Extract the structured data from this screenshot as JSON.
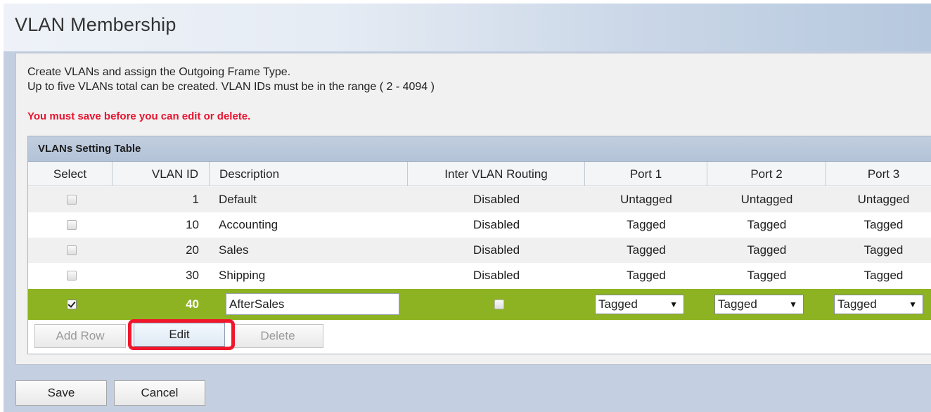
{
  "page": {
    "title": "VLAN Membership"
  },
  "intro": {
    "line1": "Create VLANs and assign the Outgoing Frame Type.",
    "line2": "Up to five VLANs total can be created. VLAN IDs must be in the range ( 2 - 4094 )",
    "warning": "You must save before you can edit or delete.",
    "warning_color": "#e8132e"
  },
  "table": {
    "caption": "VLANs Setting Table",
    "headers": {
      "select": "Select",
      "vlan_id": "VLAN ID",
      "description": "Description",
      "routing": "Inter VLAN Routing",
      "port1": "Port 1",
      "port2": "Port 2",
      "port3": "Port 3"
    },
    "rows": [
      {
        "checked": false,
        "vlan_id": "1",
        "description": "Default",
        "routing": "Disabled",
        "port1": "Untagged",
        "port2": "Untagged",
        "port3": "Untagged"
      },
      {
        "checked": false,
        "vlan_id": "10",
        "description": "Accounting",
        "routing": "Disabled",
        "port1": "Tagged",
        "port2": "Tagged",
        "port3": "Tagged"
      },
      {
        "checked": false,
        "vlan_id": "20",
        "description": "Sales",
        "routing": "Disabled",
        "port1": "Tagged",
        "port2": "Tagged",
        "port3": "Tagged"
      },
      {
        "checked": false,
        "vlan_id": "30",
        "description": "Shipping",
        "routing": "Disabled",
        "port1": "Tagged",
        "port2": "Tagged",
        "port3": "Tagged"
      }
    ],
    "edit_row": {
      "checked": true,
      "vlan_id": "40",
      "description_value": "AfterSales",
      "routing_checked": false,
      "port1": "Tagged",
      "port2": "Tagged",
      "port3": "Tagged",
      "highlight_color": "#8db322"
    },
    "actions": {
      "add_row": "Add Row",
      "edit": "Edit",
      "delete": "Delete"
    }
  },
  "footer": {
    "save": "Save",
    "cancel": "Cancel"
  },
  "annotation_color": "#f0162c",
  "icons": {
    "dropdown": "dropdown-arrow-icon",
    "checkbox": "checkbox-icon"
  }
}
